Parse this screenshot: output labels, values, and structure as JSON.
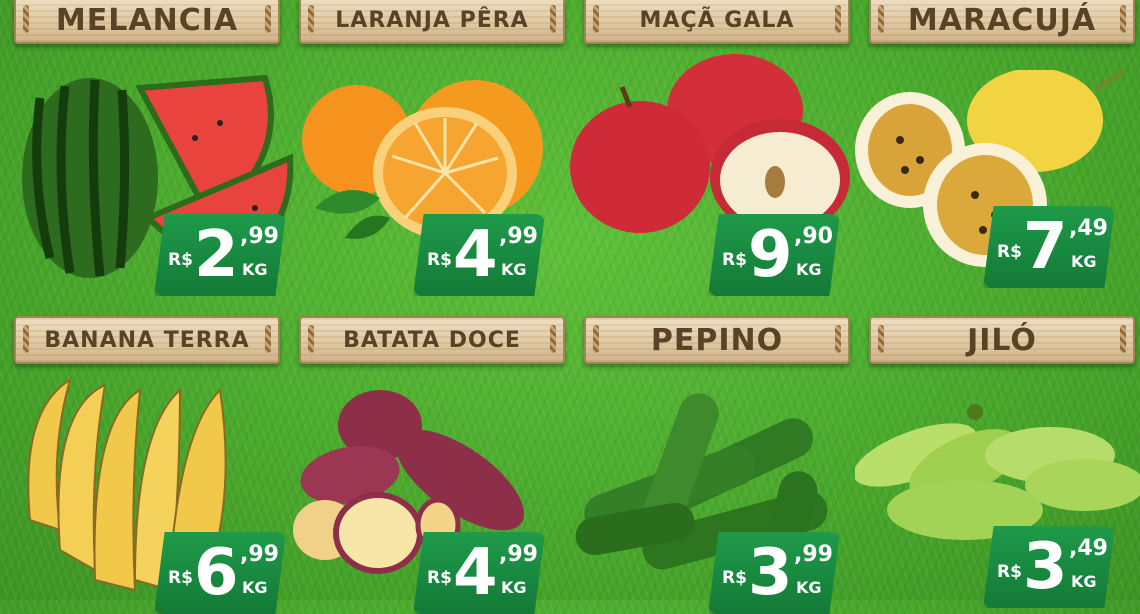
{
  "products": [
    {
      "name": "MELANCIA",
      "currency": "R$",
      "price_int": "2",
      "price_cents": ",99",
      "unit": "KG"
    },
    {
      "name": "LARANJA PÊRA",
      "currency": "R$",
      "price_int": "4",
      "price_cents": ",99",
      "unit": "KG"
    },
    {
      "name": "MAÇÃ GALA",
      "currency": "R$",
      "price_int": "9",
      "price_cents": ",90",
      "unit": "KG"
    },
    {
      "name": "MARACUJÁ",
      "currency": "R$",
      "price_int": "7",
      "price_cents": ",49",
      "unit": "KG"
    },
    {
      "name": "BANANA TERRA",
      "currency": "R$",
      "price_int": "6",
      "price_cents": ",99",
      "unit": "KG"
    },
    {
      "name": "BATATA DOCE",
      "currency": "R$",
      "price_int": "4",
      "price_cents": ",99",
      "unit": "KG"
    },
    {
      "name": "PEPINO",
      "currency": "R$",
      "price_int": "3",
      "price_cents": ",99",
      "unit": "KG"
    },
    {
      "name": "JILÓ",
      "currency": "R$",
      "price_int": "3",
      "price_cents": ",49",
      "unit": "KG"
    }
  ],
  "colors": {
    "price_badge": "#137a37",
    "sign_text": "#5a4226",
    "background": "#4aa92c"
  }
}
